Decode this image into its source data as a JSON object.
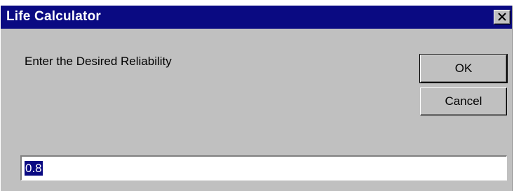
{
  "window": {
    "title": "Life Calculator",
    "close_icon": "close-icon"
  },
  "dialog": {
    "prompt": "Enter the Desired Reliability",
    "ok_label": "OK",
    "cancel_label": "Cancel",
    "input_value": "0.8"
  },
  "colors": {
    "titlebar": "#0a0a82",
    "face": "#c0c0c0",
    "selection": "#0a0a82"
  }
}
